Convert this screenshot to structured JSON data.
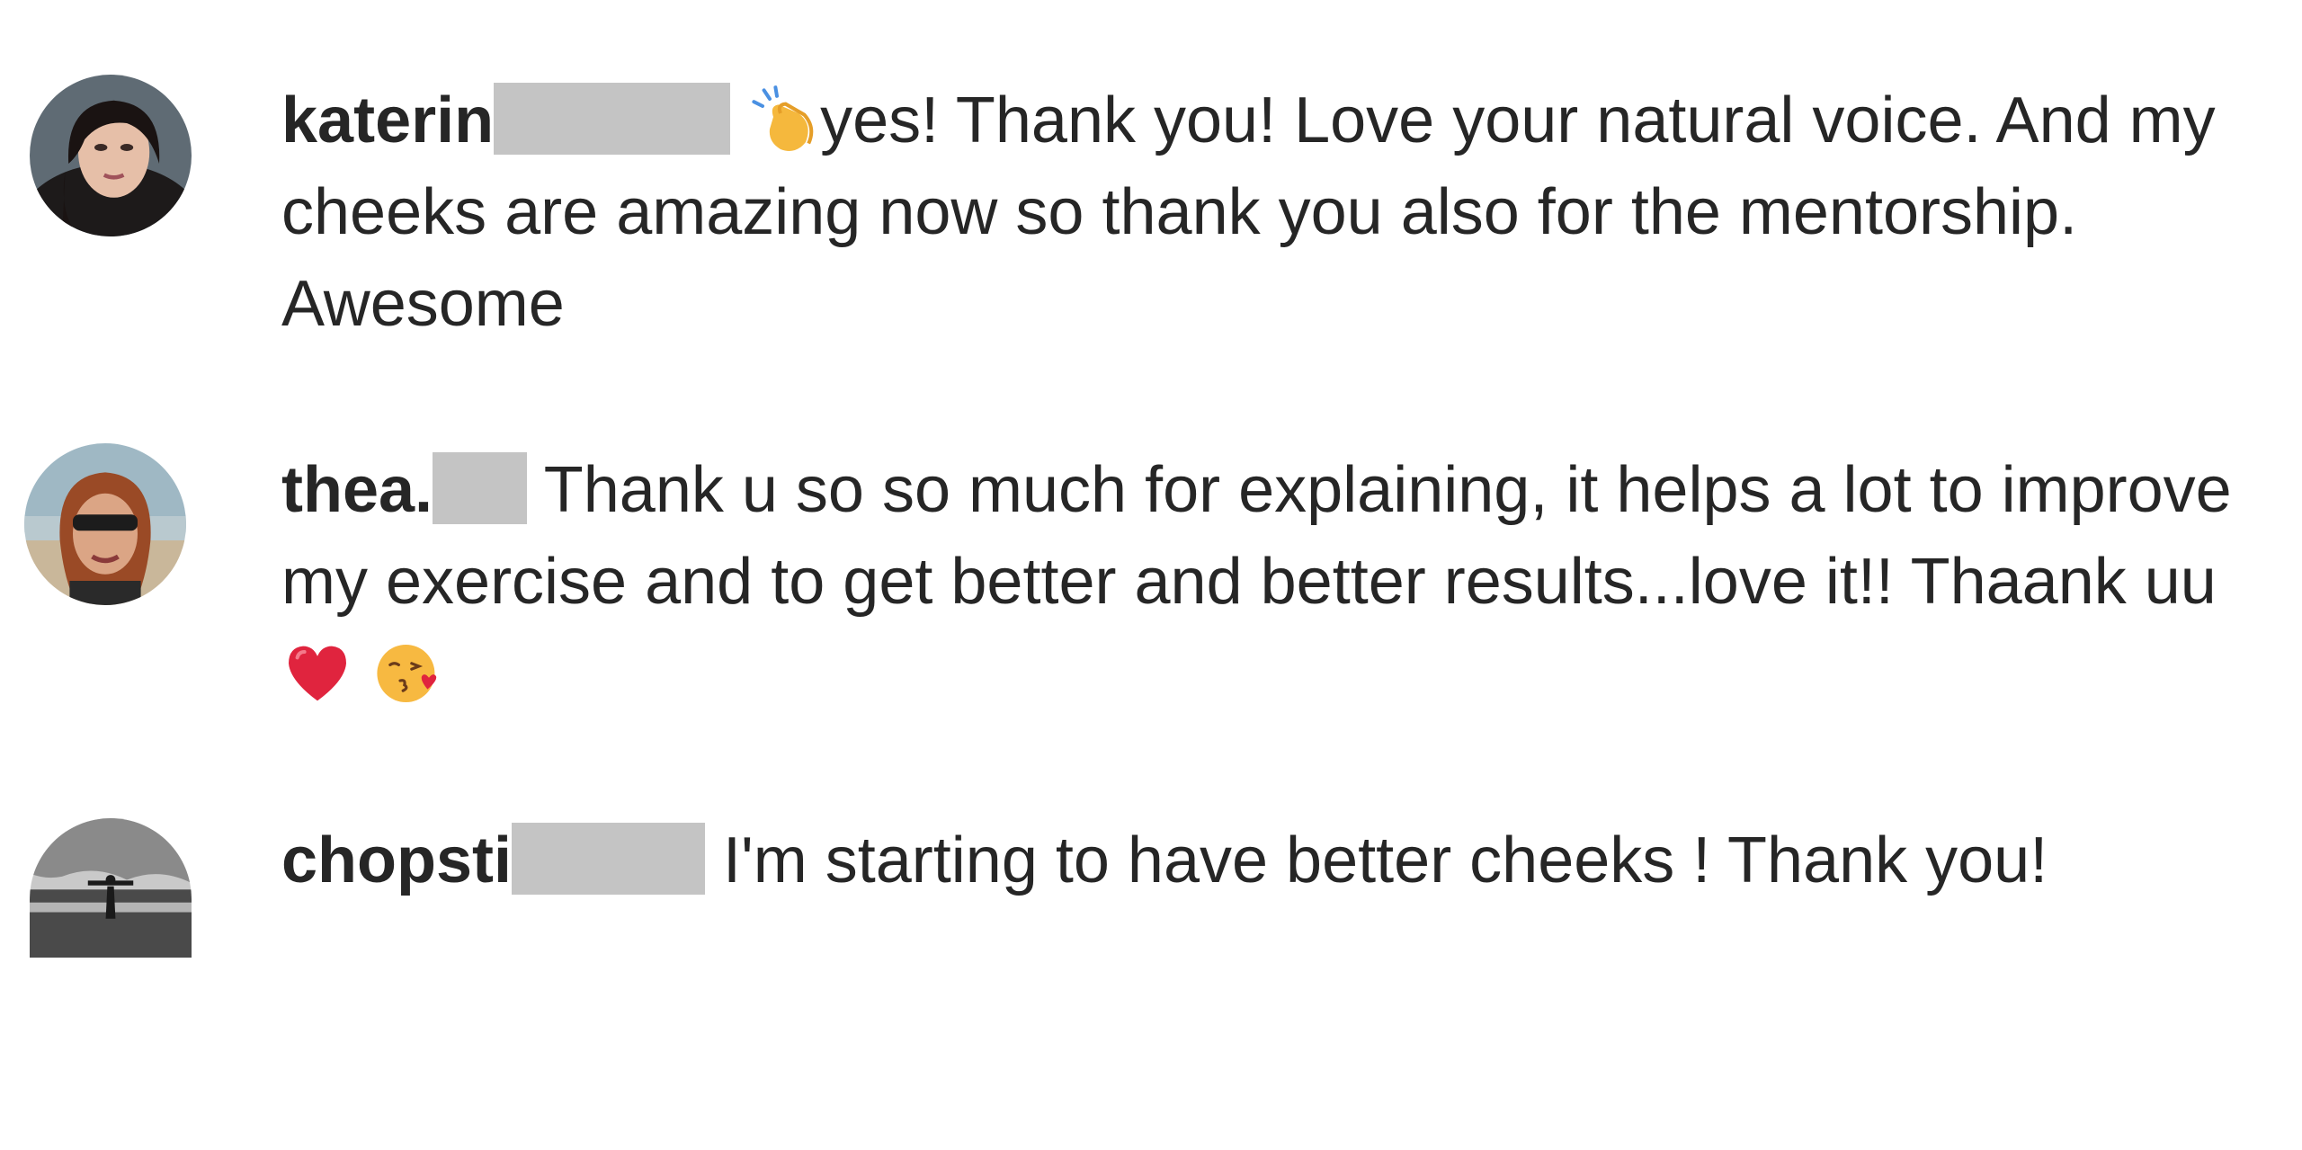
{
  "comments": [
    {
      "username": "katerin",
      "emoji_before": "clapping-hands-icon",
      "text": "yes! Thank you! Love your natural voice. And my cheeks are amazing now so thank you also for the mentorship. Awesome"
    },
    {
      "username": "thea.",
      "text": "Thank u so so much for explaining, it helps a lot to improve my exercise and to get better and better results...love it!! Thaank uu",
      "emoji_after": [
        "red-heart-icon",
        "face-blowing-kiss-icon"
      ]
    },
    {
      "username": "chopsti",
      "text": "I'm starting to have better cheeks ! Thank you!"
    }
  ],
  "colors": {
    "text": "#262626",
    "redaction": "#c4c4c4",
    "background": "#ffffff"
  }
}
